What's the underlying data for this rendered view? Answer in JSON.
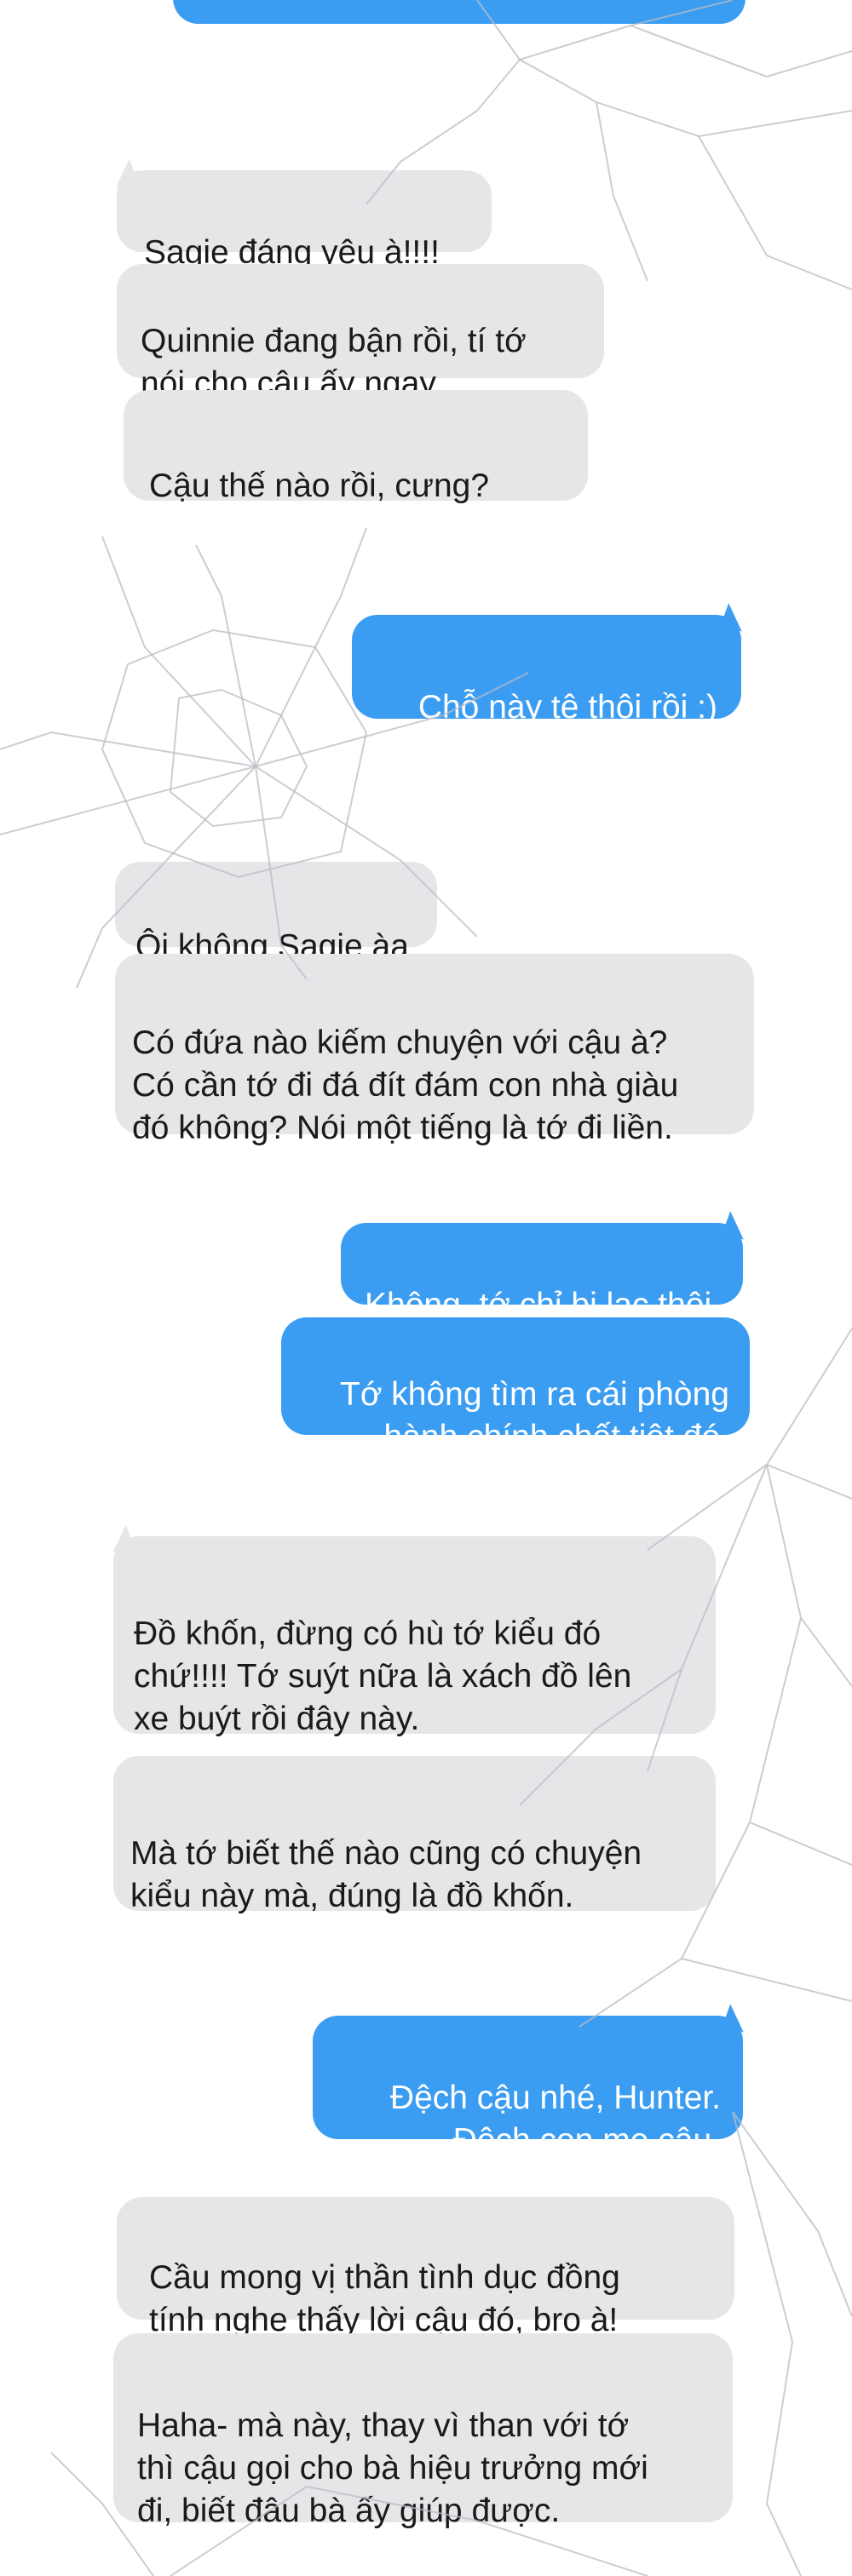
{
  "messages": [
    {
      "side": "out",
      "text": ""
    },
    {
      "side": "in",
      "text": "Sagie đáng yêu à!!!!"
    },
    {
      "side": "in",
      "text": "Quinnie đang bận rồi, tí tớ\nnói cho cậu ấy ngay."
    },
    {
      "side": "in",
      "text": "Cậu thế nào rồi, cưng?"
    },
    {
      "side": "out",
      "text": "Chỗ này tệ thôi rồi :)"
    },
    {
      "side": "in",
      "text": "Ôi không Sagie àa"
    },
    {
      "side": "in",
      "text": "Có đứa nào kiếm chuyện với cậu à?\nCó cần tớ đi đá đít đám con nhà giàu\nđó không? Nói một tiếng là tớ đi liền."
    },
    {
      "side": "out",
      "text": "Không, tớ chỉ bị lạc thôi."
    },
    {
      "side": "out",
      "text": "Tớ không tìm ra cái phòng\nhành chính chết tiệt đó."
    },
    {
      "side": "in",
      "text": "Đồ khốn, đừng có hù tớ kiểu đó\nchứ!!!! Tớ suýt nữa là xách đồ lên\nxe buýt rồi đây này."
    },
    {
      "side": "in",
      "text": "Mà tớ biết thế nào cũng có chuyện\nkiểu này mà, đúng là đồ khốn."
    },
    {
      "side": "out",
      "text": "Đệch cậu nhé, Hunter.\nĐệch con mẹ cậu."
    },
    {
      "side": "in",
      "text": "Cầu mong vị thần tình dục đồng\ntính nghe thấy lời cậu đó, bro à!"
    },
    {
      "side": "in",
      "text": "Haha- mà này, thay vì than với tớ\nthì cậu gọi cho bà hiệu trưởng mới\nđi, biết đâu bà ấy giúp được."
    }
  ],
  "colors": {
    "incoming_bubble": "#e6e6e9",
    "outgoing_bubble": "#3b9df2",
    "incoming_text": "#1a1a1a",
    "outgoing_text": "#ffffff"
  }
}
